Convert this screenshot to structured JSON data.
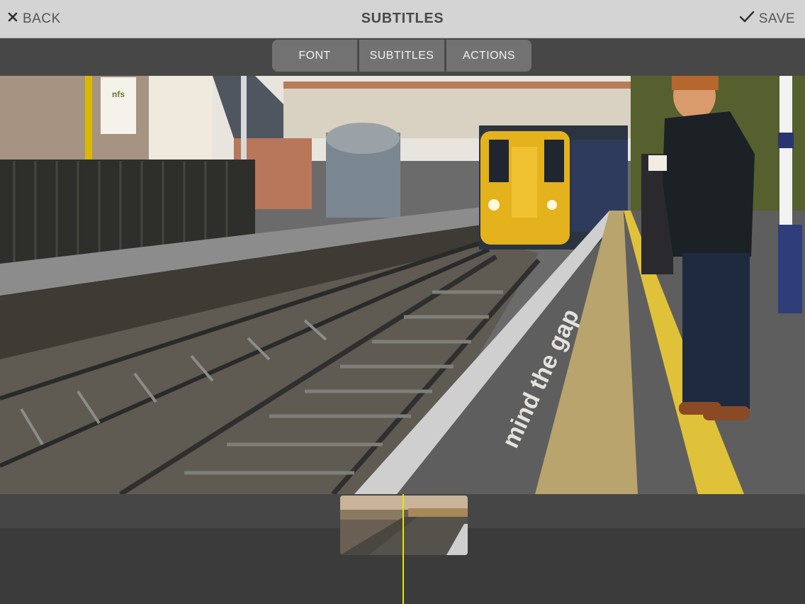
{
  "header": {
    "back_label": "BACK",
    "title": "SUBTITLES",
    "save_label": "SAVE"
  },
  "tabs": [
    {
      "label": "FONT"
    },
    {
      "label": "SUBTITLES"
    },
    {
      "label": "ACTIONS"
    }
  ],
  "video": {
    "platform_marking": "mind the gap",
    "sign_text": "nfs"
  },
  "icons": {
    "back": "close-icon",
    "save": "checkmark-icon"
  },
  "colors": {
    "topbar": "#d4d4d4",
    "tabbar": "#474747",
    "segment": "#727272",
    "timeline": "#3b3b3b",
    "playhead": "#e6e600"
  }
}
